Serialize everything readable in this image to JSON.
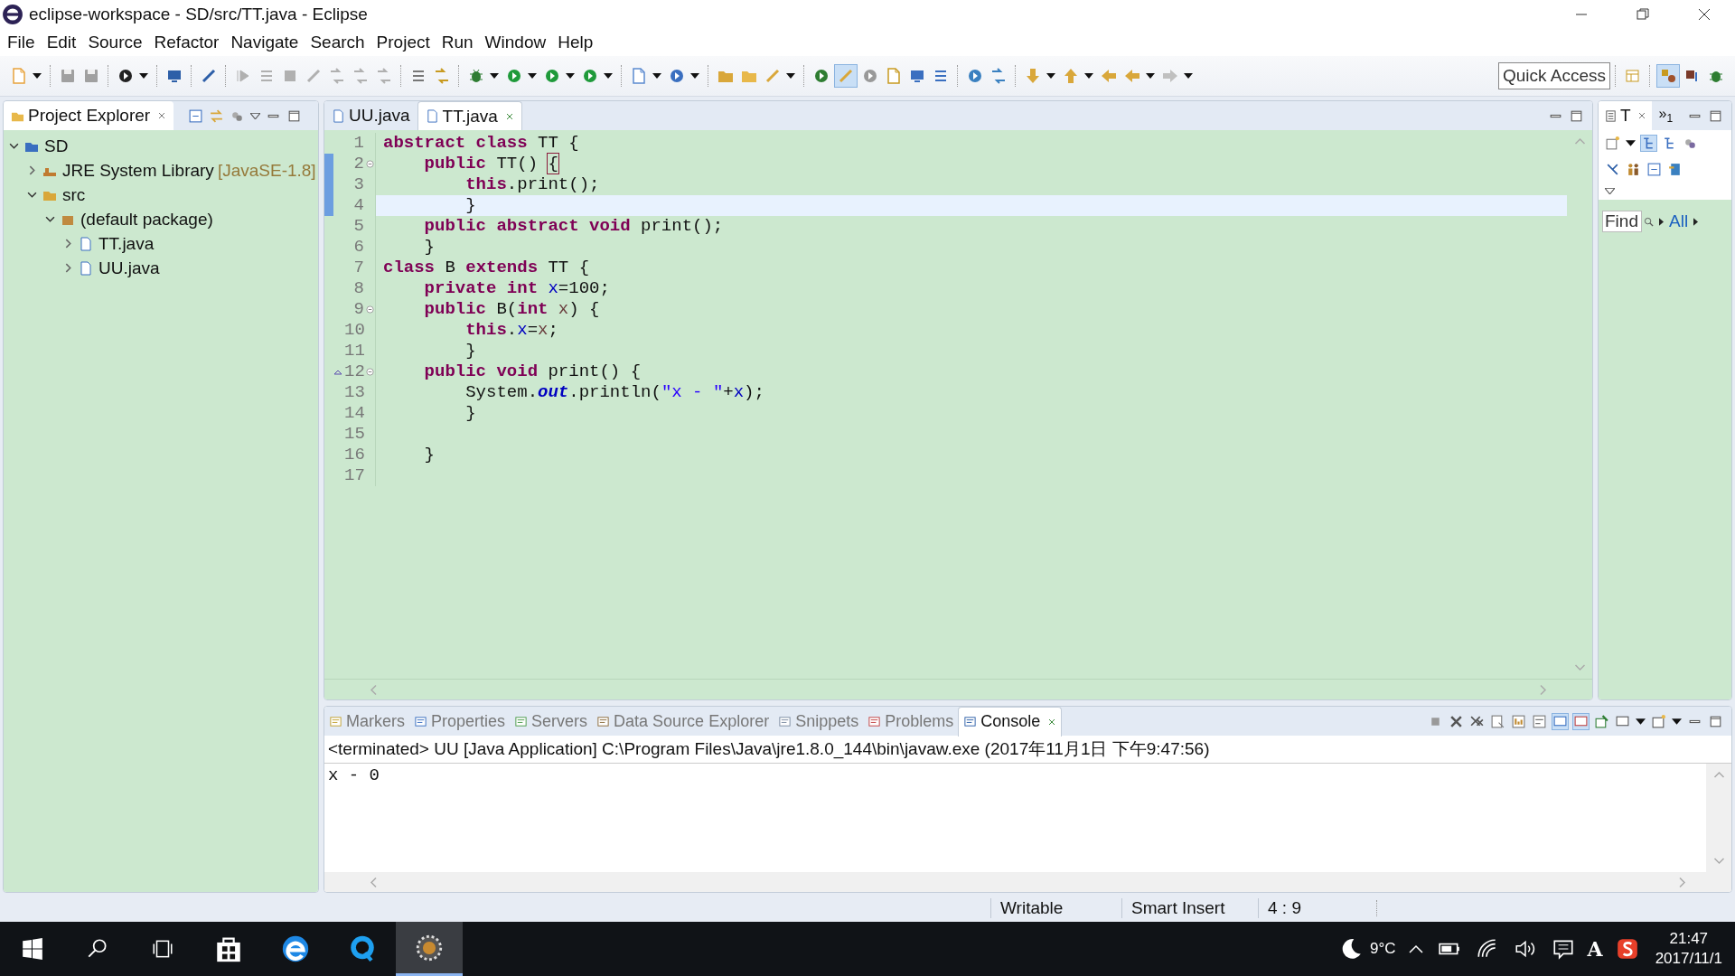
{
  "window": {
    "title": "eclipse-workspace - SD/src/TT.java - Eclipse"
  },
  "menu": [
    "File",
    "Edit",
    "Source",
    "Refactor",
    "Navigate",
    "Search",
    "Project",
    "Run",
    "Window",
    "Help"
  ],
  "quick_access": "Quick Access",
  "project_explorer": {
    "title": "Project Explorer",
    "tree": [
      {
        "label": "SD",
        "kind": "project",
        "expanded": true,
        "children": [
          {
            "label": "JRE System Library",
            "decoration": "[JavaSE-1.8]",
            "kind": "library",
            "expanded": false
          },
          {
            "label": "src",
            "kind": "source-folder",
            "expanded": true,
            "children": [
              {
                "label": "(default package)",
                "kind": "package",
                "expanded": true,
                "children": [
                  {
                    "label": "TT.java",
                    "kind": "java-file",
                    "expanded": false
                  },
                  {
                    "label": "UU.java",
                    "kind": "java-file",
                    "expanded": false
                  }
                ]
              }
            ]
          }
        ]
      }
    ]
  },
  "editor": {
    "tabs": [
      {
        "label": "UU.java",
        "selected": false
      },
      {
        "label": "TT.java",
        "selected": true
      }
    ],
    "lines": [
      {
        "number": "1",
        "tokens": [
          {
            "text": "abstract class",
            "kind": "keyword"
          },
          {
            "text": " TT {",
            "kind": "plain"
          }
        ]
      },
      {
        "number": "2",
        "fold": true,
        "in_range": true,
        "tokens": [
          {
            "text": "    public",
            "kind": "keyword"
          },
          {
            "text": " TT() ",
            "kind": "plain"
          },
          {
            "text": "{",
            "kind": "bracket"
          }
        ]
      },
      {
        "number": "3",
        "in_range": true,
        "tokens": [
          {
            "text": "        this",
            "kind": "keyword"
          },
          {
            "text": ".print();",
            "kind": "plain"
          }
        ]
      },
      {
        "number": "4",
        "in_range": true,
        "current": true,
        "tokens": [
          {
            "text": "        }",
            "kind": "plain"
          }
        ]
      },
      {
        "number": "5",
        "tokens": [
          {
            "text": "    public abstract void",
            "kind": "keyword"
          },
          {
            "text": " print();",
            "kind": "plain"
          }
        ]
      },
      {
        "number": "6",
        "tokens": [
          {
            "text": "    }",
            "kind": "plain"
          }
        ]
      },
      {
        "number": "7",
        "tokens": [
          {
            "text": "class",
            "kind": "keyword"
          },
          {
            "text": " B ",
            "kind": "plain"
          },
          {
            "text": "extends",
            "kind": "keyword"
          },
          {
            "text": " TT {",
            "kind": "plain"
          }
        ]
      },
      {
        "number": "8",
        "tokens": [
          {
            "text": "    private int ",
            "kind": "keyword"
          },
          {
            "text": "x",
            "kind": "field"
          },
          {
            "text": "=100;",
            "kind": "plain"
          }
        ]
      },
      {
        "number": "9",
        "fold": true,
        "tokens": [
          {
            "text": "    public",
            "kind": "keyword"
          },
          {
            "text": " B(",
            "kind": "plain"
          },
          {
            "text": "int ",
            "kind": "keyword"
          },
          {
            "text": "x",
            "kind": "param"
          },
          {
            "text": ") {",
            "kind": "plain"
          }
        ]
      },
      {
        "number": "10",
        "tokens": [
          {
            "text": "        this",
            "kind": "keyword"
          },
          {
            "text": ".",
            "kind": "plain"
          },
          {
            "text": "x",
            "kind": "field"
          },
          {
            "text": "=",
            "kind": "plain"
          },
          {
            "text": "x",
            "kind": "param"
          },
          {
            "text": ";",
            "kind": "plain"
          }
        ]
      },
      {
        "number": "11",
        "tokens": [
          {
            "text": "        }",
            "kind": "plain"
          }
        ]
      },
      {
        "number": "12",
        "fold": true,
        "override": true,
        "tokens": [
          {
            "text": "    public void",
            "kind": "keyword"
          },
          {
            "text": " print() {",
            "kind": "plain"
          }
        ]
      },
      {
        "number": "13",
        "tokens": [
          {
            "text": "        System.",
            "kind": "plain"
          },
          {
            "text": "out",
            "kind": "static"
          },
          {
            "text": ".println(",
            "kind": "plain"
          },
          {
            "text": "\"x - \"",
            "kind": "string"
          },
          {
            "text": "+",
            "kind": "plain"
          },
          {
            "text": "x",
            "kind": "field"
          },
          {
            "text": ");",
            "kind": "plain"
          }
        ]
      },
      {
        "number": "14",
        "tokens": [
          {
            "text": "        }",
            "kind": "plain"
          }
        ]
      },
      {
        "number": "15"
      },
      {
        "number": "16",
        "tokens": [
          {
            "text": "    }",
            "kind": "plain"
          }
        ]
      },
      {
        "number": "17"
      }
    ]
  },
  "outline": {
    "tab": "T",
    "overflow_chevron": "»",
    "overflow_count": "1",
    "find_placeholder": "Find",
    "all_link": "All"
  },
  "bottom_panel": {
    "tabs": [
      {
        "label": "Markers",
        "selected": false
      },
      {
        "label": "Properties",
        "selected": false
      },
      {
        "label": "Servers",
        "selected": false
      },
      {
        "label": "Data Source Explorer",
        "selected": false
      },
      {
        "label": "Snippets",
        "selected": false
      },
      {
        "label": "Problems",
        "selected": false
      },
      {
        "label": "Console",
        "selected": true
      }
    ],
    "console_header": "<terminated> UU [Java Application] C:\\Program Files\\Java\\jre1.8.0_144\\bin\\javaw.exe (2017年11月1日 下午9:47:56)",
    "output": [
      "x - 0"
    ]
  },
  "status_bar": [
    "Writable",
    "Smart Insert",
    "4 : 9"
  ],
  "taskbar": {
    "apps": [
      {
        "kind": "store",
        "active": false
      },
      {
        "kind": "browser",
        "active": false
      },
      {
        "kind": "chat",
        "active": false
      },
      {
        "kind": "eclipse",
        "active": true
      }
    ],
    "weather": "9°C",
    "ime": "A",
    "time": "21:47",
    "date": "2017/11/1"
  }
}
